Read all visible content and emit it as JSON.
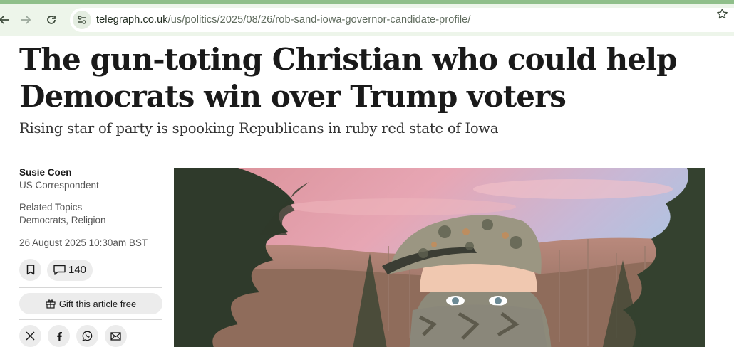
{
  "browser": {
    "url_host": "telegraph.co.uk",
    "url_path": "/us/politics/2025/08/26/rob-sand-iowa-governor-candidate-profile/",
    "icons": {
      "back": "arrow-left-icon",
      "forward": "arrow-right-icon",
      "reload": "reload-icon",
      "site_settings": "tune-icon",
      "bookmark": "star-icon"
    },
    "colors": {
      "frame": "#8fbf8a",
      "toolbar": "#edf5ea"
    }
  },
  "article": {
    "headline": "The gun-toting Christian who could help Democrats win over Trump voters",
    "standfirst": "Rising star of party is spooking Republicans in ruby red state of Iowa",
    "author": {
      "name": "Susie Coen",
      "role": "US Correspondent"
    },
    "topics": {
      "label": "Related Topics",
      "links": "Democrats, Religion"
    },
    "date": "26 August 2025 10:30am BST",
    "actions": {
      "comment_count": "140",
      "gift_label": "Gift this article free"
    },
    "share_icons": [
      "x-icon",
      "facebook-icon",
      "whatsapp-icon",
      "email-icon"
    ]
  }
}
